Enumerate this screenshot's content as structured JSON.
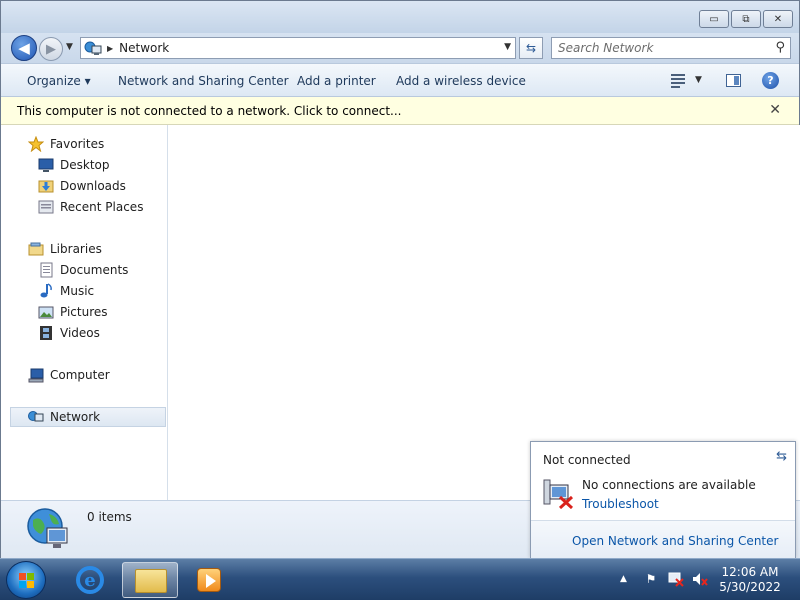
{
  "window": {
    "minimize": "▭",
    "maximize": "⧉",
    "close": "✕"
  },
  "address": {
    "crumb": "Network"
  },
  "search": {
    "placeholder": "Search Network"
  },
  "toolbar": {
    "organize": "Organize ▾",
    "network_sharing": "Network and Sharing Center",
    "add_printer": "Add a printer",
    "add_wireless": "Add a wireless device"
  },
  "infobar": {
    "message": "This computer is not connected to a network. Click to connect...",
    "close": "✕"
  },
  "navpane": {
    "favorites": "Favorites",
    "desktop": "Desktop",
    "downloads": "Downloads",
    "recent_places": "Recent Places",
    "libraries": "Libraries",
    "documents": "Documents",
    "music": "Music",
    "pictures": "Pictures",
    "videos": "Videos",
    "computer": "Computer",
    "network": "Network"
  },
  "details": {
    "count": "0 items"
  },
  "popup": {
    "title": "Not connected",
    "status": "No connections are available",
    "troubleshoot": "Troubleshoot",
    "open_center": "Open Network and Sharing Center"
  },
  "taskbar": {
    "time": "12:06 AM",
    "date": "5/30/2022"
  },
  "colors": {
    "accent": "#1e395b",
    "link": "#0b56a8",
    "infobar": "#ffffe1"
  }
}
